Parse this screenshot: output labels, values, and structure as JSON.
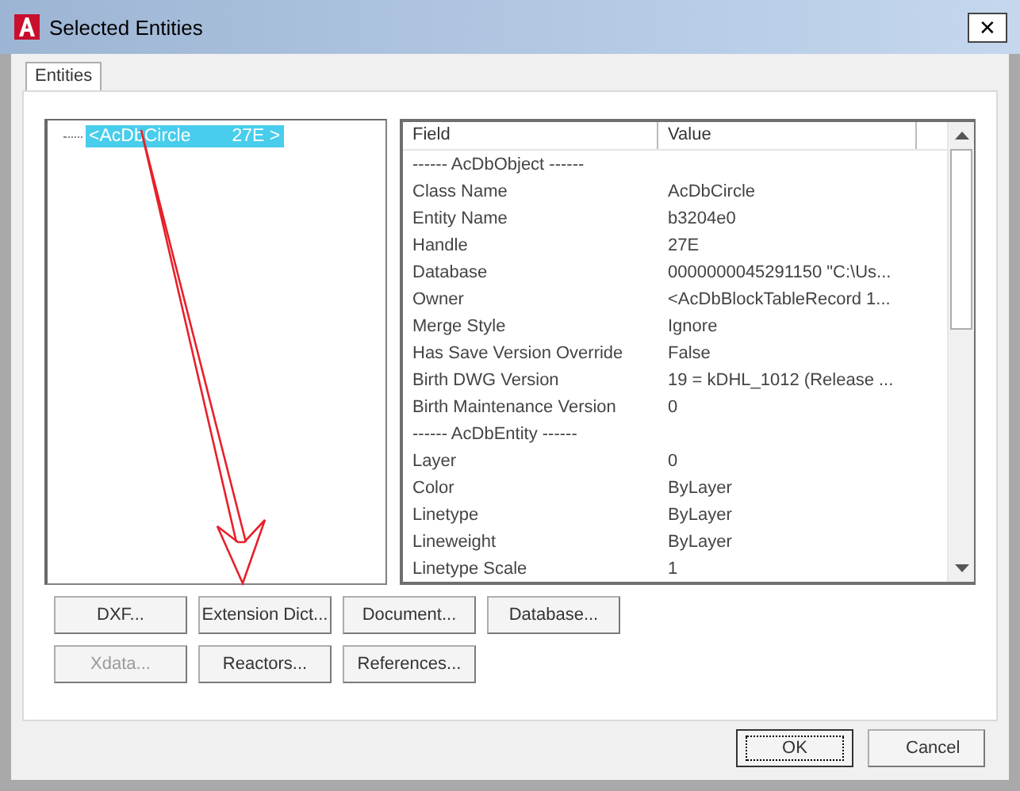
{
  "window": {
    "title": "Selected Entities",
    "close": "✕"
  },
  "tabs": [
    {
      "label": "Entities",
      "selected": true
    }
  ],
  "tree": {
    "items": [
      {
        "label": "<AcDbCircle",
        "handle": "27E >",
        "selected": true
      }
    ]
  },
  "table": {
    "columns": [
      "Field",
      "Value"
    ],
    "rows": [
      {
        "kind": "section",
        "field": "------ AcDbObject ------"
      },
      {
        "kind": "pair",
        "field": "Class Name",
        "value": "AcDbCircle"
      },
      {
        "kind": "pair",
        "field": "Entity Name",
        "value": "b3204e0"
      },
      {
        "kind": "pair",
        "field": "Handle",
        "value": "27E"
      },
      {
        "kind": "pair",
        "field": "Database",
        "value": "0000000045291150  \"C:\\Us..."
      },
      {
        "kind": "pair",
        "field": "Owner",
        "value": "<AcDbBlockTableRecord 1..."
      },
      {
        "kind": "pair",
        "field": "Merge Style",
        "value": "Ignore"
      },
      {
        "kind": "pair",
        "field": "Has Save Version Override",
        "value": "False"
      },
      {
        "kind": "pair",
        "field": "Birth DWG Version",
        "value": "19 = kDHL_1012  (Release ..."
      },
      {
        "kind": "pair",
        "field": "Birth Maintenance Version",
        "value": "0"
      },
      {
        "kind": "section",
        "field": "------ AcDbEntity ------"
      },
      {
        "kind": "pair",
        "field": "Layer",
        "value": "0"
      },
      {
        "kind": "pair",
        "field": "Color",
        "value": "ByLayer"
      },
      {
        "kind": "pair",
        "field": "Linetype",
        "value": "ByLayer"
      },
      {
        "kind": "pair",
        "field": "Lineweight",
        "value": "ByLayer"
      },
      {
        "kind": "pair",
        "field": "Linetype Scale",
        "value": "1"
      }
    ]
  },
  "button_rows": [
    [
      {
        "label": "DXF...",
        "disabled": false
      },
      {
        "label": "Extension Dict...",
        "disabled": false
      },
      {
        "label": "Document...",
        "disabled": false
      },
      {
        "label": "Database...",
        "disabled": false
      }
    ],
    [
      {
        "label": "Xdata...",
        "disabled": true
      },
      {
        "label": "Reactors...",
        "disabled": false
      },
      {
        "label": "References...",
        "disabled": false
      }
    ]
  ],
  "dialog_buttons": [
    {
      "label": "OK",
      "focused": true
    },
    {
      "label": "Cancel",
      "focused": false
    }
  ]
}
